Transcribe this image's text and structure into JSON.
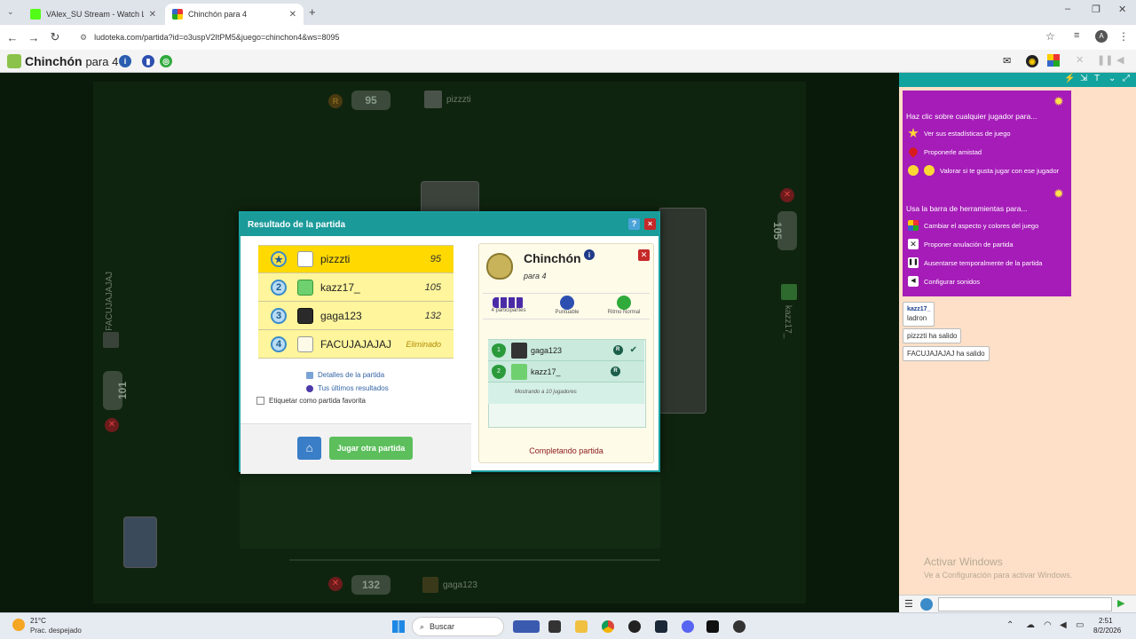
{
  "browser": {
    "tabs": [
      {
        "label": "VAlex_SU Stream - Watch Live o",
        "active": false
      },
      {
        "label": "Chinchón para 4",
        "active": true
      }
    ],
    "url": "ludoteka.com/partida?id=o3uspV2ItPM5&juego=chinchon4&ws=8095"
  },
  "site": {
    "title": "Chinchón",
    "subtitle": "para 4"
  },
  "game": {
    "top_player": {
      "score": "95",
      "name": "pizzzti",
      "badge": "R"
    },
    "right_player": {
      "score": "105",
      "name": "kazz17_"
    },
    "left_player": {
      "score": "101",
      "name": "FACUJAJAJAJ"
    },
    "bottom_player": {
      "score": "132",
      "name": "gaga123"
    }
  },
  "dialog": {
    "title": "Resultado de la partida",
    "help_label": "?",
    "close_label": "×",
    "results": [
      {
        "rank": "1",
        "name": "pizzzti",
        "score": "95"
      },
      {
        "rank": "2",
        "name": "kazz17_",
        "score": "105"
      },
      {
        "rank": "3",
        "name": "gaga123",
        "score": "132"
      },
      {
        "rank": "4",
        "name": "FACUJAJAJAJ",
        "score": "Eliminado"
      }
    ],
    "links": {
      "details": "Detalles de la partida",
      "last_results": "Tus últimos resultados",
      "favorite": "Etiquetar como partida favorita"
    },
    "play_again": "Jugar otra partida",
    "panel": {
      "title": "Chinchón",
      "subtitle": "para 4",
      "stats": [
        "4 participantes",
        "Puntuable",
        "Ritmo Normal"
      ],
      "players": [
        {
          "pos": "1",
          "name": "gaga123",
          "badge": "R",
          "check": "✔"
        },
        {
          "pos": "2",
          "name": "kazz17_",
          "badge": "R"
        }
      ],
      "showing": "Mostrando a 10 jugadores",
      "status": "Completando partida"
    }
  },
  "sidebar": {
    "help_title_1": "Haz clic sobre cualquier jugador para...",
    "items_1": [
      "Ver sus estadísticas de juego",
      "Proponerle amistad",
      "Valorar si te gusta jugar con ese jugador"
    ],
    "help_title_2": "Usa la barra de herramientas para...",
    "items_2": [
      "Cambiar el aspecto y colores del juego",
      "Proponer anulación de partida",
      "Ausentarse temporalmente de la partida",
      "Configurar sonidos"
    ],
    "chat_user": "kazz17_",
    "chat_msg": "ladron",
    "events": [
      "pizzzti ha salido",
      "FACUJAJAJAJ ha salido"
    ],
    "watermark_1": "Activar Windows",
    "watermark_2": "Ve a Configuración para activar Windows."
  },
  "taskbar": {
    "weather_temp": "21°C",
    "weather_desc": "Prac. despejado",
    "search": "Buscar",
    "time": "2:51",
    "date": "8/2/2026"
  }
}
